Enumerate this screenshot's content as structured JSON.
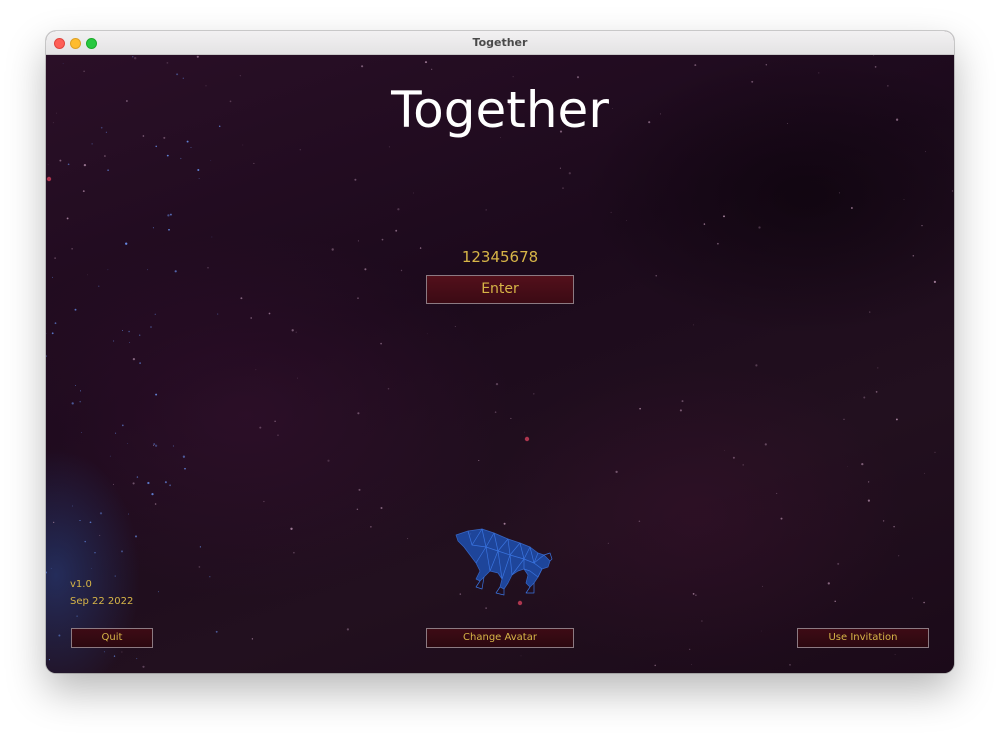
{
  "window": {
    "title": "Together"
  },
  "app": {
    "heading": "Together",
    "code_value": "12345678",
    "enter_label": "Enter",
    "version": "v1.0",
    "build_date": "Sep 22 2022"
  },
  "footer": {
    "quit_label": "Quit",
    "change_avatar_label": "Change Avatar",
    "use_invitation_label": "Use Invitation"
  },
  "avatar": {
    "icon": "wireframe-panther-icon"
  },
  "colors": {
    "accent_text": "#d7b547",
    "button_fill": "#53101b",
    "background": "#1c0a1c",
    "avatar": "#2a5cc4"
  }
}
